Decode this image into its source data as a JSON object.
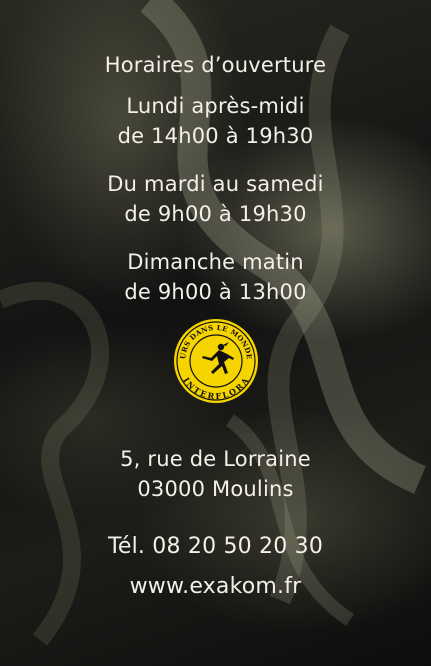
{
  "hours": {
    "title": "Horaires d’ouverture",
    "monday_day": "Lundi après-midi",
    "monday_time": "de 14h00 à 19h30",
    "weekday_day": "Du mardi au samedi",
    "weekday_time": "de 9h00 à 19h30",
    "sunday_day": "Dimanche matin",
    "sunday_time": "de 9h00 à 13h00"
  },
  "logo": {
    "ring_text": "DES FLEURS DANS LE MONDE ENTIER",
    "brand": "INTERFLORA",
    "ring_color": "#f5d400",
    "icon": "mercury-runner-icon"
  },
  "address": {
    "street": "5, rue de Lorraine",
    "city": "03000 Moulins"
  },
  "contact": {
    "phone": "Tél. 08 20 50 20 30",
    "website": "www.exakom.fr"
  }
}
